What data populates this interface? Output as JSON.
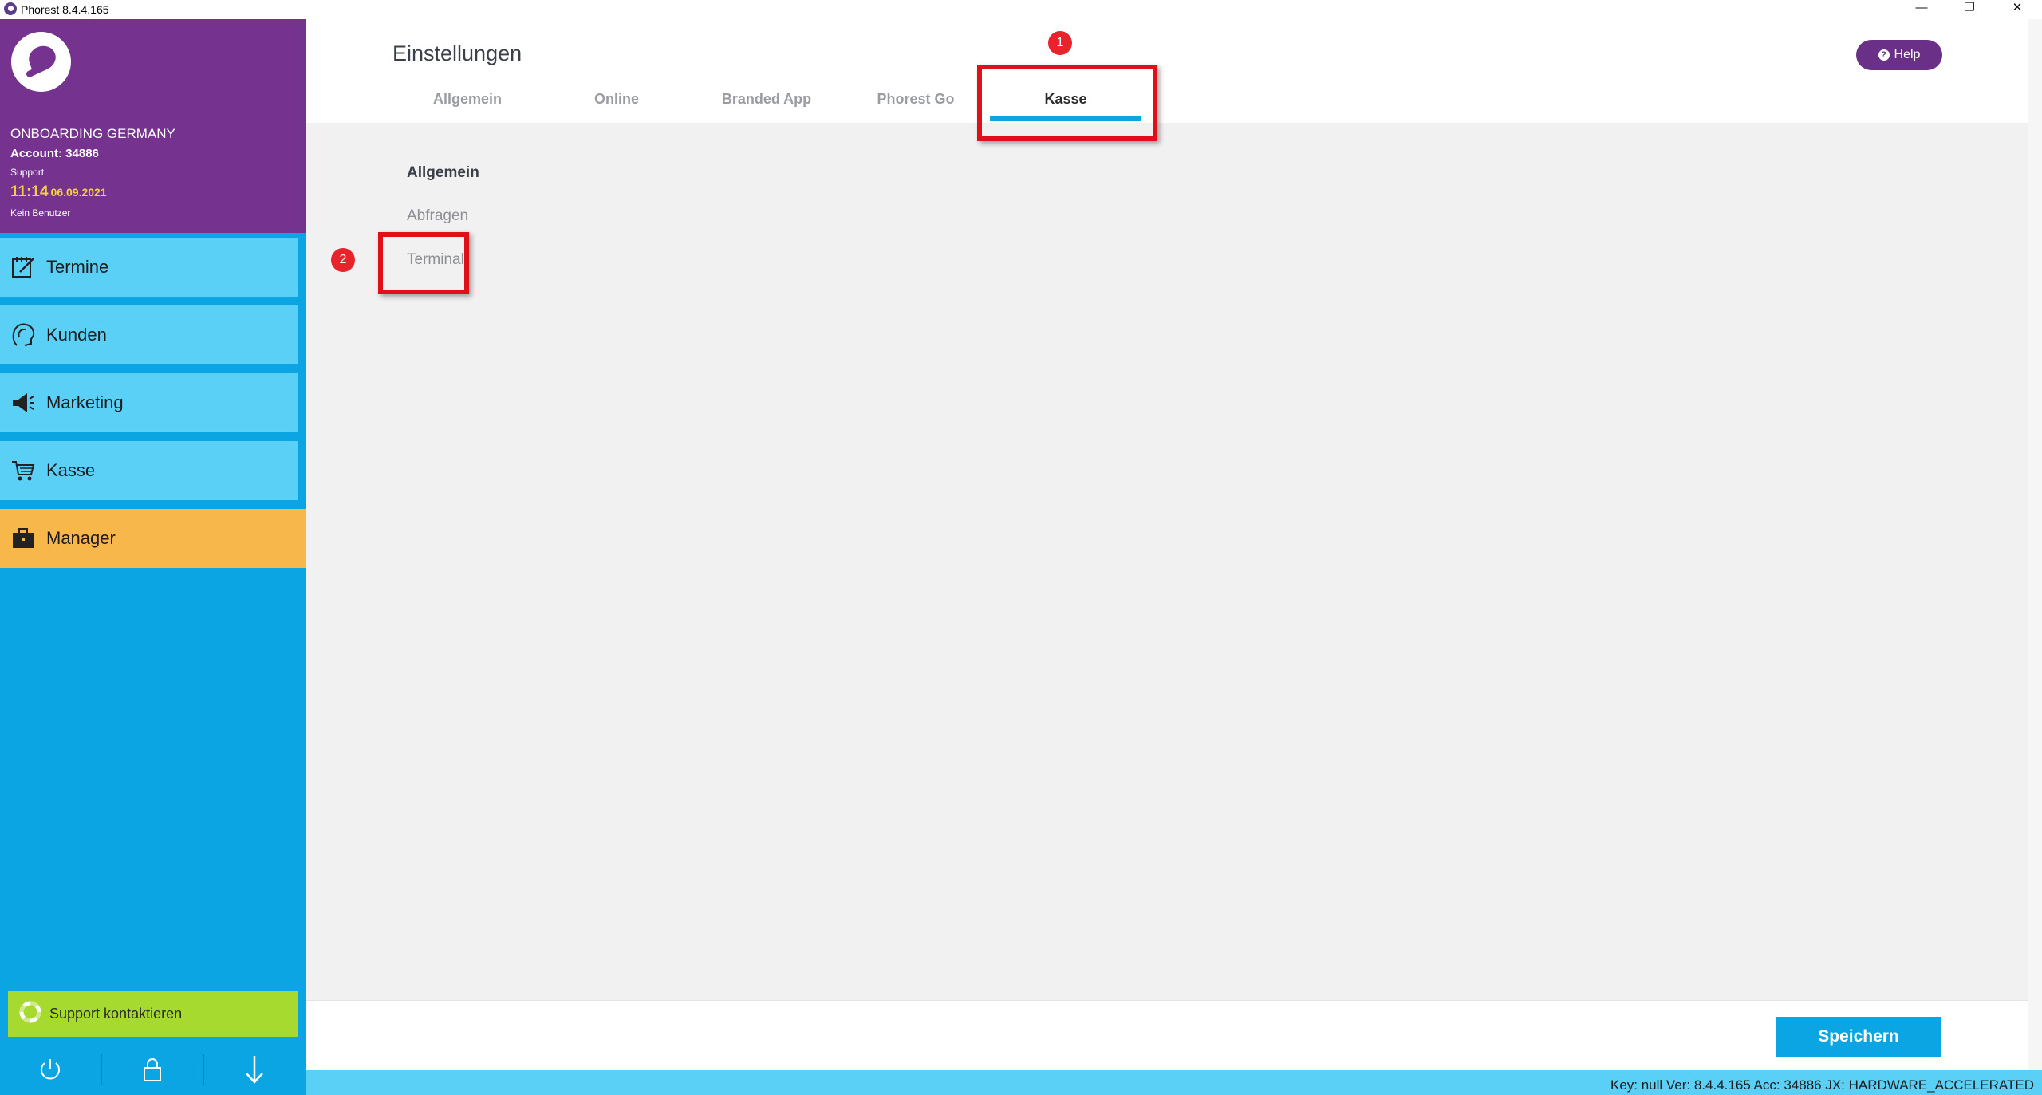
{
  "window": {
    "title": "Phorest 8.4.4.165",
    "minimize_glyph": "—",
    "restore_glyph": "❐",
    "close_glyph": "✕"
  },
  "profile": {
    "business_name": "ONBOARDING GERMANY",
    "account": "Account: 34886",
    "role": "Support",
    "time": "11:14",
    "date": "06.09.2021",
    "user": "Kein Benutzer"
  },
  "nav": {
    "items": [
      {
        "label": "Termine",
        "icon": "calendar-edit-icon"
      },
      {
        "label": "Kunden",
        "icon": "customer-head-icon"
      },
      {
        "label": "Marketing",
        "icon": "megaphone-icon"
      },
      {
        "label": "Kasse",
        "icon": "cart-icon"
      },
      {
        "label": "Manager",
        "icon": "briefcase-icon"
      }
    ]
  },
  "support": {
    "label": "Support kontaktieren",
    "icon": "lifebuoy-icon"
  },
  "bottom_icons": [
    "power-icon",
    "lock-icon",
    "download-arrow-icon"
  ],
  "header": {
    "title": "Einstellungen",
    "tabs": [
      "Allgemein",
      "Online",
      "Branded App",
      "Phorest Go",
      "Kasse"
    ],
    "active_tab": "Kasse",
    "help_label": "Help"
  },
  "settings_list": {
    "heading": "Allgemein",
    "items": [
      "Abfragen",
      "Terminal"
    ]
  },
  "annotations": {
    "badge_1": "1",
    "badge_2": "2",
    "color": "#e0101a"
  },
  "footer": {
    "save_label": "Speichern"
  },
  "status_bar": {
    "text": "Key: null Ver: 8.4.4.165 Acc: 34886  JX: HARDWARE_ACCELERATED"
  },
  "colors": {
    "sidebar_blue": "#0aa5e2",
    "nav_light_blue": "#5bd0f7",
    "profile_purple": "#75338f",
    "manager_orange": "#f8b74b",
    "support_green": "#a6da2e",
    "help_purple": "#6a2f86"
  }
}
